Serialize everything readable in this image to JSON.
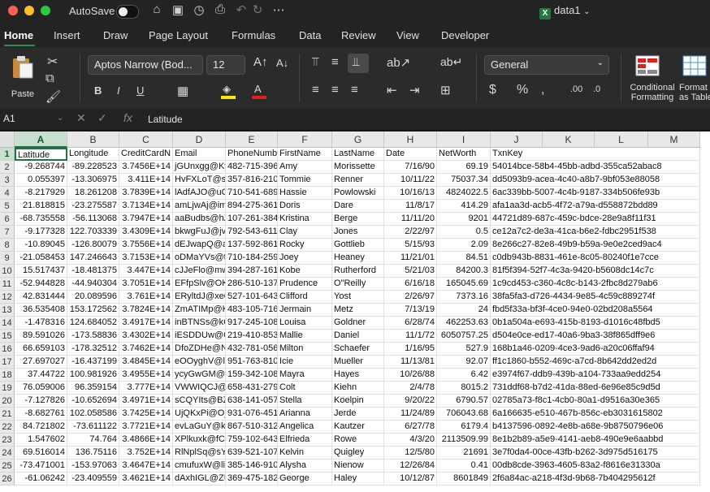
{
  "window": {
    "autosave_label": "AutoSave",
    "doc_title": "data1",
    "traffic_colors": [
      "#ff5f57",
      "#febc2e",
      "#28c840"
    ]
  },
  "menu": {
    "tabs": [
      "Home",
      "Insert",
      "Draw",
      "Page Layout",
      "Formulas",
      "Data",
      "Review",
      "View",
      "Developer"
    ],
    "active": "Home"
  },
  "ribbon": {
    "paste_label": "Paste",
    "font_name": "Aptos Narrow (Bod...",
    "font_size": "12",
    "number_format": "General",
    "conditional_formatting": "Conditional",
    "conditional_formatting2": "Formatting",
    "format_as_table": "Format",
    "format_as_table2": "as Table",
    "accent_color": "#217346"
  },
  "formula_bar": {
    "name_box": "A1",
    "formula": "Latitude"
  },
  "grid": {
    "columns": [
      "A",
      "B",
      "C",
      "D",
      "E",
      "F",
      "G",
      "H",
      "I",
      "J",
      "K",
      "L",
      "M"
    ],
    "rows": [
      [
        "Latitude",
        "Longitude",
        "CreditCardN",
        "Email",
        "PhoneNumbe",
        "FirstName",
        "LastName",
        "Date",
        "NetWorth",
        "TxnKey"
      ],
      [
        "-9.268744",
        "-89.228523",
        "3.7456E+14",
        "jGUnxgg@Ky",
        "482-715-396",
        "Amy",
        "Morissette",
        "7/16/90",
        "69.19",
        "54014bce-58b4-45bb-adbd-355ca52abac8"
      ],
      [
        "0.055397",
        "-13.306975",
        "3.411E+14",
        "HvFXLoT@sA",
        "357-816-210",
        "Tommie",
        "Renner",
        "10/11/22",
        "75037.34",
        "dd5093b9-acea-4c40-a8b7-9bf053e88058"
      ],
      [
        "-8.217929",
        "18.261208",
        "3.7839E+14",
        "lAdfAJO@uO",
        "710-541-689",
        "Hassie",
        "Powlowski",
        "10/16/13",
        "4824022.5",
        "6ac339bb-5007-4c4b-9187-334b506fe93b"
      ],
      [
        "21.818815",
        "-23.275587",
        "3.7134E+14",
        "amLjwAj@im",
        "894-275-361",
        "Doris",
        "Dare",
        "11/8/17",
        "414.29",
        "afa1aa3d-acb5-4f72-a79a-d558872bdd89"
      ],
      [
        "-68.735558",
        "-56.113068",
        "3.7947E+14",
        "aaBudbs@hZ",
        "107-261-384",
        "Kristina",
        "Berge",
        "11/11/20",
        "9201",
        "44721d89-687c-459c-bdce-28e9a8f11f31"
      ],
      [
        "-9.177328",
        "122.703339",
        "3.4309E+14",
        "bkwgFuJ@jv",
        "792-543-611",
        "Clay",
        "Jones",
        "2/22/97",
        "0.5",
        "ce12a7c2-de3a-41ca-b6e2-fdbc2951f538"
      ],
      [
        "-10.89045",
        "-126.80079",
        "3.7556E+14",
        "dEJwapQ@al",
        "137-592-861",
        "Rocky",
        "Gottlieb",
        "5/15/93",
        "2.09",
        "8e266c27-82e8-49b9-b59a-9e0e2ced9ac4"
      ],
      [
        "-21.058453",
        "147.246643",
        "3.7153E+14",
        "oDMaYVs@tc",
        "710-184-259",
        "Joey",
        "Heaney",
        "11/21/01",
        "84.51",
        "c0db943b-8831-461e-8c05-80240f1e7cce"
      ],
      [
        "15.517437",
        "-18.481375",
        "3.447E+14",
        "cJJeFlo@mw",
        "394-287-161",
        "Kobe",
        "Rutherford",
        "5/21/03",
        "84200.3",
        "81f5f394-52f7-4c3a-9420-b5608dc14c7c"
      ],
      [
        "-52.944828",
        "-44.940304",
        "3.7051E+14",
        "EFfpSlv@OKf",
        "286-510-137",
        "Prudence",
        "O\"Reilly",
        "6/16/18",
        "165045.69",
        "1c9cd453-c360-4c8c-b143-2fbc8d279ab6"
      ],
      [
        "42.831444",
        "20.089596",
        "3.761E+14",
        "ERyltdJ@xeC",
        "527-101-643",
        "Clifford",
        "Yost",
        "2/26/97",
        "7373.16",
        "38fa5fa3-d726-4434-9e85-4c59c889274f"
      ],
      [
        "36.535408",
        "153.172562",
        "3.7824E+14",
        "ZmATIMp@KS",
        "483-105-716",
        "Jermain",
        "Metz",
        "7/13/19",
        "24",
        "fbd5f33a-bf3f-4ce0-94e0-02bd208a5564"
      ],
      [
        "-1.478316",
        "124.684052",
        "3.4917E+14",
        "inBTNSs@kC",
        "917-245-108",
        "Louisa",
        "Goldner",
        "6/28/74",
        "462253.63",
        "0b1a504a-e693-415b-8193-d1016c48fbd5"
      ],
      [
        "89.591026",
        "-173.58836",
        "3.4302E+14",
        "iESDDUw@C",
        "219-410-853",
        "Mallie",
        "Daniel",
        "11/1/72",
        "6050757.25",
        "d504e0ce-ed17-40a6-9ba3-38f865dff9e6"
      ],
      [
        "66.659103",
        "-178.32512",
        "3.7462E+14",
        "DfoZDHe@N",
        "432-781-056",
        "Milton",
        "Schaefer",
        "1/16/95",
        "527.9",
        "168b1a46-0209-4ce3-9ad6-a20c06ffaf94"
      ],
      [
        "27.697027",
        "-16.437199",
        "3.4845E+14",
        "eOOyghV@le",
        "951-763-810",
        "Icie",
        "Mueller",
        "11/13/81",
        "92.07",
        "ff1c1860-b552-469c-a7cd-8b642dd2ed2d"
      ],
      [
        "37.44722",
        "100.981926",
        "3.4955E+14",
        "ycyGwGM@f",
        "159-342-108",
        "Mayra",
        "Hayes",
        "10/26/88",
        "6.42",
        "e3974f67-ddb9-439b-a104-733aa9edd254"
      ],
      [
        "76.059006",
        "96.359154",
        "3.777E+14",
        "VWWIQCJ@r",
        "658-431-279",
        "Colt",
        "Kiehn",
        "2/4/78",
        "8015.2",
        "731ddf68-b7d2-41da-88ed-6e96e85c9d5d"
      ],
      [
        "-7.127826",
        "-10.652694",
        "3.4971E+14",
        "sCQYIts@BZ",
        "638-141-057",
        "Stella",
        "Koelpin",
        "9/20/22",
        "6790.57",
        "02785a73-f8c1-4cb0-80a1-d9516a30e365"
      ],
      [
        "-8.682761",
        "102.058586",
        "3.7425E+14",
        "UjQKxPi@Ojf",
        "931-076-451",
        "Arianna",
        "Jerde",
        "11/24/89",
        "706043.68",
        "6a166635-e510-467b-856c-eb3031615802"
      ],
      [
        "84.721802",
        "-73.611122",
        "3.7721E+14",
        "evLaGuY@kx",
        "867-510-312",
        "Angelica",
        "Kautzer",
        "6/27/78",
        "6179.4",
        "b4137596-0892-4e8b-a68e-9b8750796e06"
      ],
      [
        "1.547602",
        "74.764",
        "3.4866E+14",
        "XPlkuxk@fCn",
        "759-102-643",
        "Elfrieda",
        "Rowe",
        "4/3/20",
        "2113509.99",
        "8e1b2b89-a5e9-4141-aeb8-490e9e6aabbd"
      ],
      [
        "69.516014",
        "136.75116",
        "3.752E+14",
        "RlNplSq@sYl",
        "639-521-107",
        "Kelvin",
        "Quigley",
        "12/5/80",
        "21691",
        "3e7f0da4-00ce-43fb-b262-3d975d516175"
      ],
      [
        "-73.471001",
        "-153.97063",
        "3.4647E+14",
        "cmufuxW@li",
        "385-146-910",
        "Alysha",
        "Nienow",
        "12/26/84",
        "0.41",
        "00db8cde-3963-4605-83a2-f8616e31330a"
      ],
      [
        "-61.06242",
        "-23.409559",
        "3.4621E+14",
        "dAxhIGL@ZU",
        "369-475-182",
        "George",
        "Haley",
        "10/12/87",
        "8601849",
        "2f6a84ac-a218-4f3d-9b68-7b404295612f"
      ]
    ]
  }
}
